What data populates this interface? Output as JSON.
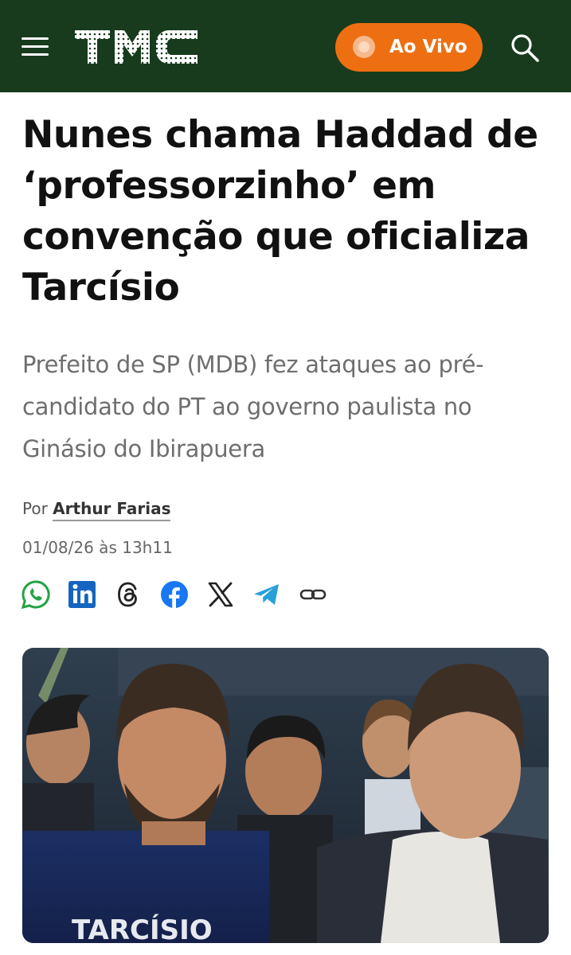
{
  "header": {
    "logo_text": "TMC",
    "live_label": "Ao Vivo",
    "background": "#173b1c",
    "live_color": "#ee6f12"
  },
  "article": {
    "headline": "Nunes chama Haddad de ‘professorzinho’ em convenção que oficializa Tarcísio",
    "subtitle": "Prefeito de SP (MDB) fez ataques ao pré-candidato do PT ao governo paulista no Ginásio do Ibirapuera",
    "by_prefix": "Por",
    "author": "Arthur Farias",
    "datetime": "01/08/26 às 13h11"
  },
  "share": {
    "icons": [
      "whatsapp-icon",
      "linkedin-icon",
      "threads-icon",
      "facebook-icon",
      "x-icon",
      "telegram-icon",
      "link-icon"
    ]
  },
  "photo": {
    "shirt_text": "TARCÍSIO"
  }
}
